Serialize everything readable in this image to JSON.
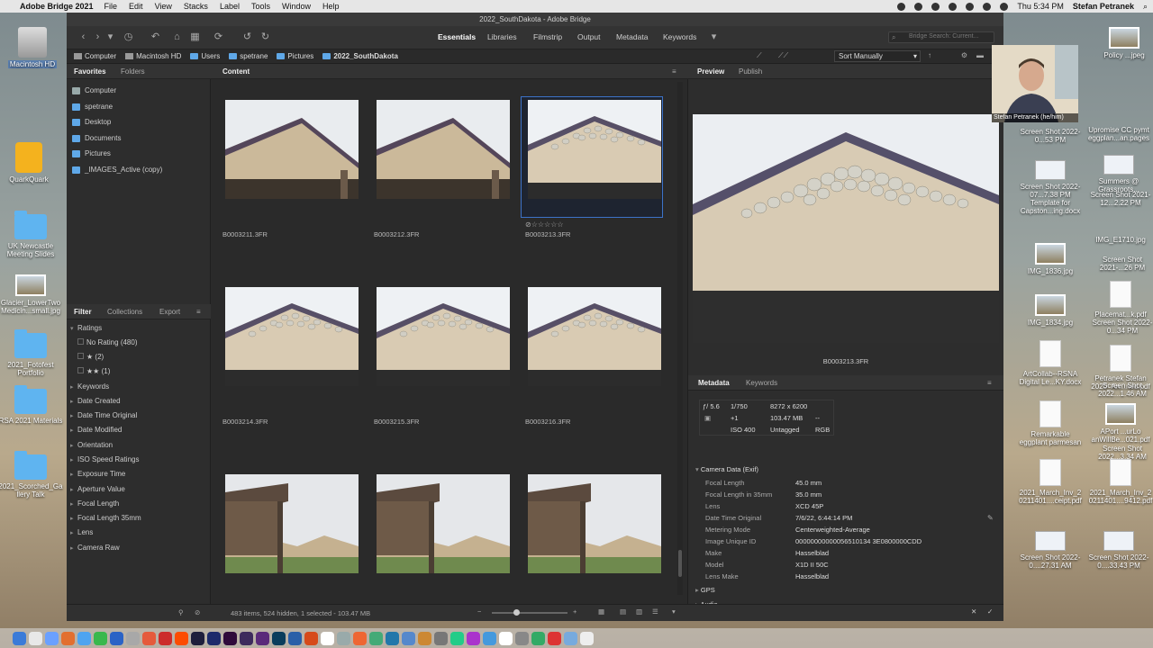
{
  "menubar": {
    "app_name": "Adobe Bridge 2021",
    "items": [
      "File",
      "Edit",
      "View",
      "Stacks",
      "Label",
      "Tools",
      "Window",
      "Help"
    ],
    "clock": "Thu 5:34 PM",
    "user": "Stefan Petranek"
  },
  "window": {
    "title": "2022_SouthDakota - Adobe Bridge"
  },
  "workspaces": {
    "items": [
      "Essentials",
      "Libraries",
      "Filmstrip",
      "Output",
      "Metadata",
      "Keywords"
    ],
    "active": "Essentials",
    "search_placeholder": "Bridge Search: Current..."
  },
  "path": {
    "crumbs": [
      "Computer",
      "Macintosh HD",
      "Users",
      "spetrane",
      "Pictures",
      "2022_SouthDakota"
    ],
    "sort_label": "Sort Manually"
  },
  "left_panel": {
    "tabs": [
      "Favorites",
      "Folders"
    ],
    "favorites": [
      "Computer",
      "spetrane",
      "Desktop",
      "Documents",
      "Pictures",
      "_IMAGES_Active (copy)"
    ],
    "filter_tabs": [
      "Filter",
      "Collections",
      "Export"
    ],
    "ratings_label": "Ratings",
    "ratings": [
      {
        "label": "No Rating",
        "count": "(480)"
      },
      {
        "label": "★",
        "count": "(2)"
      },
      {
        "label": "★★",
        "count": "(1)"
      }
    ],
    "filters": [
      "Keywords",
      "Date Created",
      "Date Time Original",
      "Date Modified",
      "Orientation",
      "ISO Speed Ratings",
      "Exposure Time",
      "Aperture Value",
      "Focal Length",
      "Focal Length 35mm",
      "Lens",
      "Camera Raw"
    ]
  },
  "content": {
    "tab": "Content",
    "items": [
      {
        "name": "B0003211.3FR",
        "kind": "roof"
      },
      {
        "name": "B0003212.3FR",
        "kind": "roof"
      },
      {
        "name": "B0003213.3FR",
        "kind": "nests",
        "selected": true,
        "stars": "⊘☆☆☆☆☆"
      },
      {
        "name": "B0003214.3FR",
        "kind": "nests"
      },
      {
        "name": "B0003215.3FR",
        "kind": "nests"
      },
      {
        "name": "B0003216.3FR",
        "kind": "nests"
      },
      {
        "name": "B0003217.3FR",
        "kind": "shelter"
      },
      {
        "name": "B0003218.3FR",
        "kind": "shelter"
      },
      {
        "name": "B0003219.3FR",
        "kind": "shelter"
      }
    ],
    "status": "483 items, 524 hidden, 1 selected - 103.47 MB"
  },
  "preview": {
    "tabs": [
      "Preview",
      "Publish"
    ],
    "caption": "B0003213.3FR"
  },
  "metadata": {
    "tabs": [
      "Metadata",
      "Keywords"
    ],
    "summary": {
      "aperture": "ƒ/ 5.6",
      "shutter": "1/750",
      "exposure": "+1",
      "iso": "ISO 400",
      "dimensions": "8272 x 6200",
      "size": "103.47 MB",
      "dash": "--",
      "profile": "Untagged",
      "mode": "RGB"
    },
    "section": "Camera Data (Exif)",
    "rows": [
      {
        "k": "Focal Length",
        "v": "45.0 mm"
      },
      {
        "k": "Focal Length in 35mm",
        "v": "35.0 mm"
      },
      {
        "k": "Lens",
        "v": "XCD 45P"
      },
      {
        "k": "Date Time Original",
        "v": "7/6/22, 6:44:14 PM"
      },
      {
        "k": "Metering Mode",
        "v": "Centerweighted-Average"
      },
      {
        "k": "Image Unique ID",
        "v": "00000000000056510134 3E0800000CDD"
      },
      {
        "k": "Make",
        "v": "Hasselblad"
      },
      {
        "k": "Model",
        "v": "X1D II 50C"
      },
      {
        "k": "Lens Make",
        "v": "Hasselblad"
      }
    ],
    "more_sections": [
      "GPS",
      "Audio"
    ]
  },
  "desktop_left": [
    "Macintosh HD",
    "QuarkQuark",
    "UK Newcastle Meeting Slides",
    "Glacier_LowerTwo Medicin...small.jpg",
    "2021_Fotofest Portfolio",
    "RSA 2021 Materials",
    "2021_Scorched_Ga llery Talk"
  ],
  "desktop_right": [
    "Policy ...jpeg",
    "Screen Shot 2022-0...53 PM",
    "Upromise CC pymt eggplan...an.pages",
    "Screen Shot 2022-07...7.38 PM Template for Capston...ing.docx",
    "Summers @ Grassroots...",
    "Screen Shot 2021-12...2.22 PM",
    "IMG_1836.jpg",
    "IMG_E1710.jpg",
    "Screen Shot 2021-...26 PM",
    "IMG_1834.jpg",
    "Placemat...k.pdf",
    "Screen Shot 2022-0...34 PM",
    "ArtCollab--RSNA Digital Le...KY.docx",
    "Petranek Stefan 2020_An...ned.pdf",
    "Screen Shot 2022...1.46 AM",
    "Remarkable eggplant parmesan",
    "APort ...urLo anWillBe...021.pdf",
    "Screen Shot 2022...3.34 AM",
    "2021_March_Inv_2 0211401....ceipt.pdf",
    "2021_March_Inv_2 0211401....9412.pdf",
    "Screen Shot 2022-0....27.31 AM",
    "Screen Shot 2022-0....33.43 PM"
  ],
  "webcam": {
    "label": "Stefan Petranek (he/him)"
  }
}
